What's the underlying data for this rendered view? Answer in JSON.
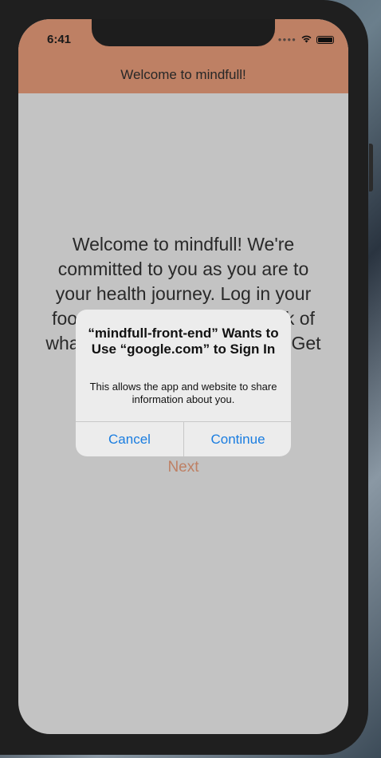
{
  "status_bar": {
    "time": "6:41",
    "signal_icon": "cellular-dots-icon",
    "wifi_icon": "wifi-icon",
    "battery_icon": "battery-icon"
  },
  "header": {
    "title": "Welcome to mindfull!"
  },
  "main": {
    "welcome_text": "Welcome to mindfull! We're committed to you as you are to your health journey. Log in your food and activity to keep track of what sets you up for success. Get started!",
    "next_label": "Next"
  },
  "alert": {
    "title": "“mindfull-front-end” Wants to Use “google.com” to Sign In",
    "message": "This allows the app and website to share information about you.",
    "cancel_label": "Cancel",
    "continue_label": "Continue"
  },
  "colors": {
    "header_bg": "#c9876a",
    "accent": "#c9876a",
    "screen_bg": "#cecece",
    "alert_button": "#1a7de0"
  }
}
